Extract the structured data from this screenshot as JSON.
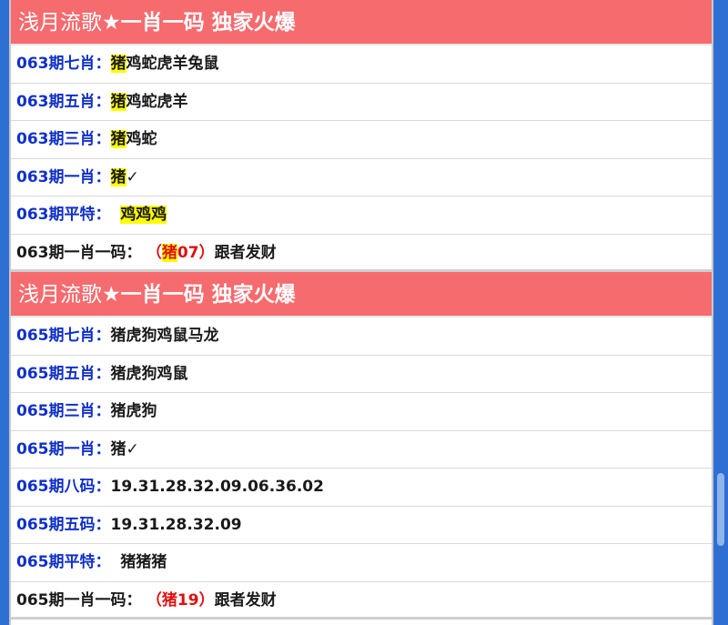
{
  "header": {
    "title_normal": "浅月流歌★",
    "title_bold": "一肖一码 独家火爆"
  },
  "issue063": {
    "rows": [
      {
        "label": "063期七肖：",
        "highlight": "猪",
        "rest": "鸡蛇虎羊兔鼠"
      },
      {
        "label": "063期五肖：",
        "highlight": "猪",
        "rest": "鸡蛇虎羊"
      },
      {
        "label": "063期三肖：",
        "highlight": "猪",
        "rest": "鸡蛇"
      },
      {
        "label": "063期一肖：",
        "highlight": "猪",
        "rest": "✓"
      }
    ],
    "pingte": {
      "label": "063期平特：",
      "value": "鸡鸡鸡"
    },
    "final": {
      "label": "063期一肖一码：",
      "open": "（",
      "highlight": "猪",
      "num": "07",
      "close": "）",
      "tail": "跟者发财"
    }
  },
  "header2": {
    "title_normal": "浅月流歌★",
    "title_bold": "一肖一码 独家火爆"
  },
  "issue065": {
    "rows": [
      {
        "label": "065期七肖：",
        "value": "猪虎狗鸡鼠马龙"
      },
      {
        "label": "065期五肖：",
        "value": "猪虎狗鸡鼠"
      },
      {
        "label": "065期三肖：",
        "value": "猪虎狗"
      },
      {
        "label": "065期一肖：",
        "value": "猪✓"
      },
      {
        "label": "065期八码：",
        "value": "19.31.28.32.09.06.36.02"
      },
      {
        "label": "065期五码：",
        "value": "19.31.28.32.09"
      },
      {
        "label": "065期平特：",
        "value": "猪猪猪"
      }
    ],
    "final": {
      "label": "065期一肖一码：",
      "value": "（猪19）",
      "tail": "跟者发财"
    }
  },
  "colors": {
    "header_bg": "#f66b6e",
    "label_blue": "#1030c8",
    "highlight": "#ffff00",
    "accent_red": "#e01010"
  }
}
